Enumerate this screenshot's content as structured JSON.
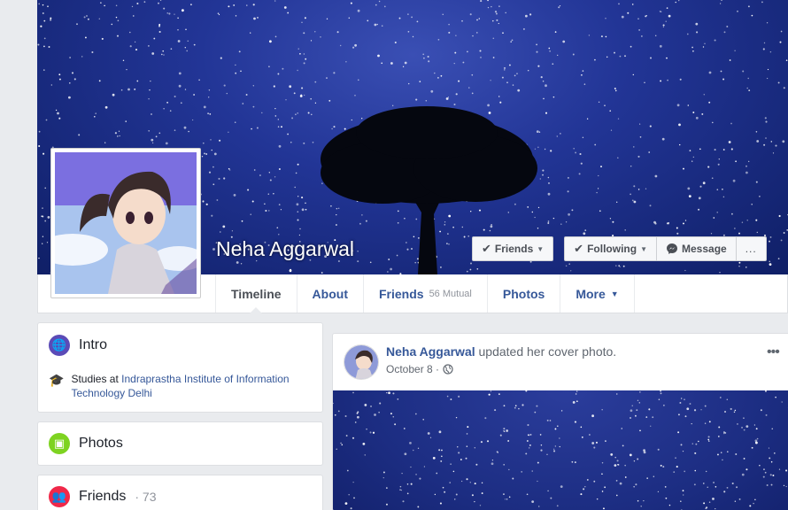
{
  "profile": {
    "name": "Neha Aggarwal"
  },
  "actions": {
    "friends": "Friends",
    "following": "Following",
    "message": "Message",
    "more_icon": "..."
  },
  "tabs": {
    "timeline": "Timeline",
    "about": "About",
    "friends": "Friends",
    "mutual": "56 Mutual",
    "photos": "Photos",
    "more": "More"
  },
  "intro": {
    "title": "Intro",
    "studies_prefix": "Studies at",
    "school": "Indraprastha Institute of Information Technology Delhi"
  },
  "photos": {
    "title": "Photos"
  },
  "friends": {
    "title": "Friends",
    "count": "· 73"
  },
  "post": {
    "author": "Neha Aggarwal",
    "action": "updated her cover photo.",
    "date": "October 8 ·",
    "menu": "•••"
  },
  "colors": {
    "link": "#365899",
    "intro_icon": "#5b4bb7",
    "photos_icon": "#7ed321",
    "friends_icon": "#f02849"
  },
  "icons": [
    "globe-icon",
    "graduation-cap-icon",
    "photo-icon",
    "friends-icon",
    "messenger-icon",
    "check-icon",
    "caret-down-icon",
    "public-globe-icon"
  ]
}
